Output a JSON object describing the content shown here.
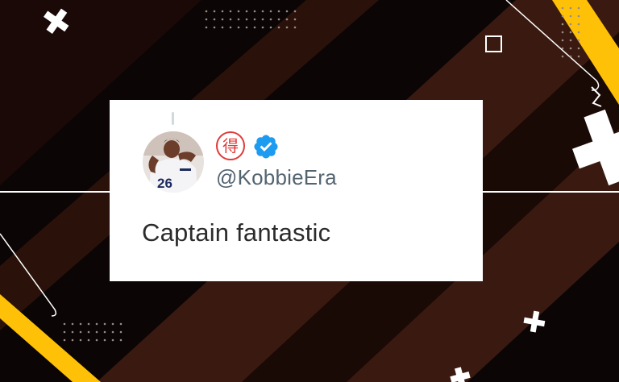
{
  "tweet": {
    "emoji_char": "得",
    "handle": "@KobbieEra",
    "text": "Captain fantastic",
    "verified": true,
    "avatar_jersey_number": "26"
  },
  "colors": {
    "background": "#0b0505",
    "stripe_brown": "#3a1a10",
    "accent_yellow": "#ffc107",
    "verified_blue": "#1d9bf0",
    "handle_gray": "#536471",
    "emoji_red": "#e03a3a"
  }
}
